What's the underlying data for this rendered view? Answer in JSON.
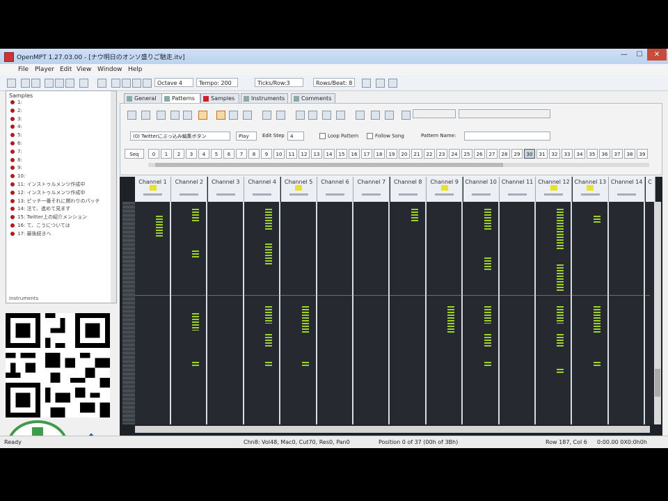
{
  "window": {
    "title": "OpenMPT 1.27.03.00 - [ナウ明日のオンソ盛りご馳走.itv]",
    "controls": {
      "minimize": "—",
      "maximize": "☐",
      "close": "✕"
    }
  },
  "menu": [
    "File",
    "Player",
    "Edit",
    "View",
    "Window",
    "Help"
  ],
  "toolbar": {
    "octave": "Octave 4",
    "tempo": "Tempo: 200",
    "ticks_row": "Ticks/Row:3",
    "rows_beat": "Rows/Beat: 8"
  },
  "samples_panel": {
    "header": "Samples",
    "items": [
      "1:",
      "2:",
      "3:",
      "4:",
      "5:",
      "6:",
      "7:",
      "8:",
      "9:",
      "10:",
      "11: インストゥルメンツ作成中",
      "12: インストゥルメンツ作成中",
      "13: ピッチ一番それに関わりのパッチ",
      "14: 注て、進めて見ます",
      "15: Twitter上の紹介メンション",
      "16: て、こうについては",
      "17: 最後続きへ"
    ],
    "footer": "Instruments"
  },
  "tabs": [
    "General",
    "Patterns",
    "Samples",
    "Instruments",
    "Comments"
  ],
  "active_tab": "Patterns",
  "pattern_panel": {
    "sequence_combo": "(0) Twitterにぶっ込み編集ボタン",
    "play_label": "Play",
    "edit_step_label": "Edit Step",
    "edit_step_value": "4",
    "loop_pattern": "Loop Pattern",
    "follow_song": "Follow Song",
    "pattern_name_label": "Pattern Name:",
    "order_prefix": "Seq",
    "orders": [
      "0",
      "1",
      "2",
      "3",
      "4",
      "5",
      "6",
      "7",
      "8",
      "9",
      "10",
      "11",
      "12",
      "13",
      "14",
      "15",
      "16",
      "17",
      "18",
      "19",
      "20",
      "21",
      "22",
      "23",
      "24",
      "25",
      "26",
      "27",
      "28",
      "29",
      "30",
      "31",
      "32",
      "33",
      "34",
      "35",
      "36",
      "37",
      "38",
      "39"
    ],
    "selected_order": "30"
  },
  "channels": [
    {
      "name": "Channel 1",
      "badge": true
    },
    {
      "name": "Channel 2",
      "badge": false
    },
    {
      "name": "Channel 3",
      "badge": false
    },
    {
      "name": "Channel 4",
      "badge": false
    },
    {
      "name": "Channel 5",
      "badge": true
    },
    {
      "name": "Channel 6",
      "badge": false
    },
    {
      "name": "Channel 7",
      "badge": false
    },
    {
      "name": "Channel 8",
      "badge": false
    },
    {
      "name": "Channel 9",
      "badge": true
    },
    {
      "name": "Channel 10",
      "badge": false
    },
    {
      "name": "Channel 11",
      "badge": false
    },
    {
      "name": "Channel 12",
      "badge": true
    },
    {
      "name": "Channel 13",
      "badge": true
    },
    {
      "name": "Channel 14",
      "badge": false
    },
    {
      "name": "C",
      "badge": false
    }
  ],
  "status": {
    "left": "Ready",
    "info": "Chn8: Vol48, Mac0, Cut70, Res0, Pan0",
    "position": "Position 0 of 37 (00h of 3Bh)",
    "row": "Row 187, Col 6",
    "time": "0:00.00  0X0:0h0h"
  },
  "colors": {
    "accent": "#9fd12b",
    "pattern_bg": "#1e2126",
    "close": "#c74c3c"
  }
}
